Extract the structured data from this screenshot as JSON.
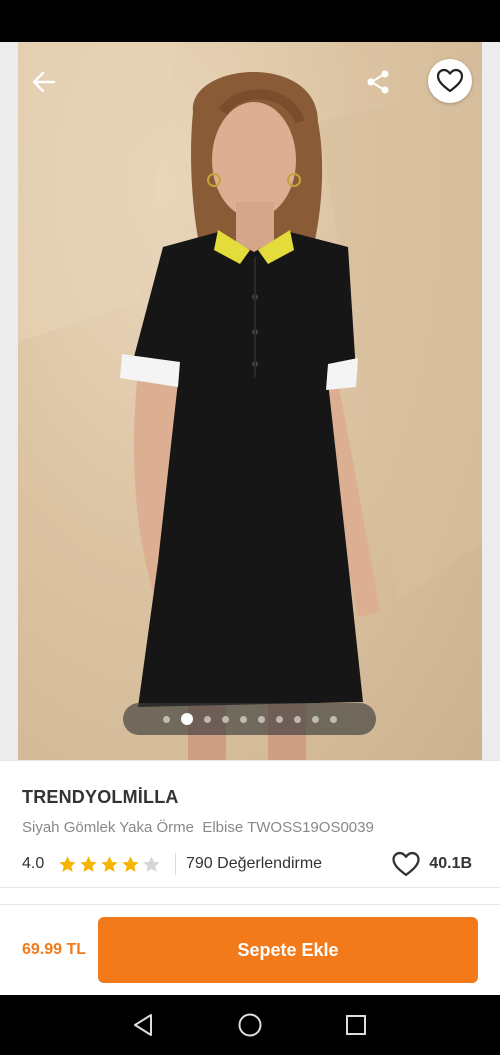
{
  "product": {
    "brand": "TRENDYOLMİLLA",
    "name": "Siyah Gömlek Yaka Örme  Elbise TWOSS19OS0039",
    "rating": "4.0",
    "rating_stars": 4,
    "rating_max": 5,
    "review_count": "790 Değerlendirme",
    "favorite_count": "40.1B"
  },
  "gallery": {
    "image_count": 10,
    "active_index": 1
  },
  "purchase": {
    "price": "69.99 TL",
    "add_to_cart_label": "Sepete Ekle"
  },
  "colors": {
    "accent": "#f27a1a",
    "star_filled": "#f5b400",
    "star_empty": "#d6d6d6"
  },
  "icons": {
    "back": "arrow-left-icon",
    "share": "share-icon",
    "favorite": "heart-outline-icon",
    "nav_back": "triangle-back-icon",
    "nav_home": "circle-home-icon",
    "nav_recents": "square-recents-icon"
  }
}
